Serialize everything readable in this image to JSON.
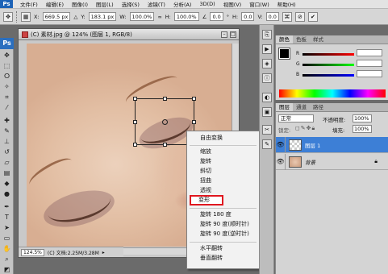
{
  "menubar": {
    "logo": "Ps",
    "items": [
      "文件(F)",
      "编辑(E)",
      "图像(I)",
      "图层(L)",
      "选择(S)",
      "滤镜(T)",
      "分析(A)",
      "3D(D)",
      "视图(V)",
      "窗口(W)",
      "帮助(H)"
    ]
  },
  "options": {
    "x_label": "X:",
    "x_value": "669.5 px",
    "y_label": "Y:",
    "y_value": "183.1 px",
    "w_label": "W:",
    "w_value": "100.0%",
    "h_label": "H:",
    "h_value": "100.0%",
    "angle_value": "0.0",
    "hskew_label": "H:",
    "hskew_value": "0.0",
    "vskew_label": "V:",
    "vskew_value": "0.0"
  },
  "toolbar": {
    "logo": "Ps"
  },
  "document": {
    "title": "(C) 素材.jpg @ 124% (图层 1, RGB/8)",
    "zoom": "124.5%",
    "doc_info": "(C) 文档:2.25M/3.28M"
  },
  "context_menu": {
    "items": [
      "自由变换",
      "缩放",
      "旋转",
      "斜切",
      "扭曲",
      "透视",
      "变形",
      "旋转 180 度",
      "旋转 90 度(顺时针)",
      "旋转 90 度(逆时针)",
      "水平翻转",
      "垂直翻转"
    ],
    "highlighted": "变形"
  },
  "color_panel": {
    "tabs": [
      "颜色",
      "色板",
      "样式"
    ],
    "r_label": "R",
    "g_label": "G",
    "b_label": "B",
    "r_value": "",
    "g_value": "",
    "b_value": ""
  },
  "layers_panel": {
    "tabs": [
      "图层",
      "通道",
      "路径"
    ],
    "blend_mode": "正常",
    "opacity_label": "不透明度:",
    "opacity_value": "100%",
    "lock_label": "锁定:",
    "fill_label": "填充:",
    "fill_value": "100%",
    "layers": [
      {
        "name": "图层 1",
        "selected": true
      },
      {
        "name": "背景",
        "selected": false
      }
    ]
  },
  "colors": {
    "accent_red": "#e0171f",
    "layer_selected": "#3d7fd6",
    "ps_blue": "#2b6fbf"
  }
}
